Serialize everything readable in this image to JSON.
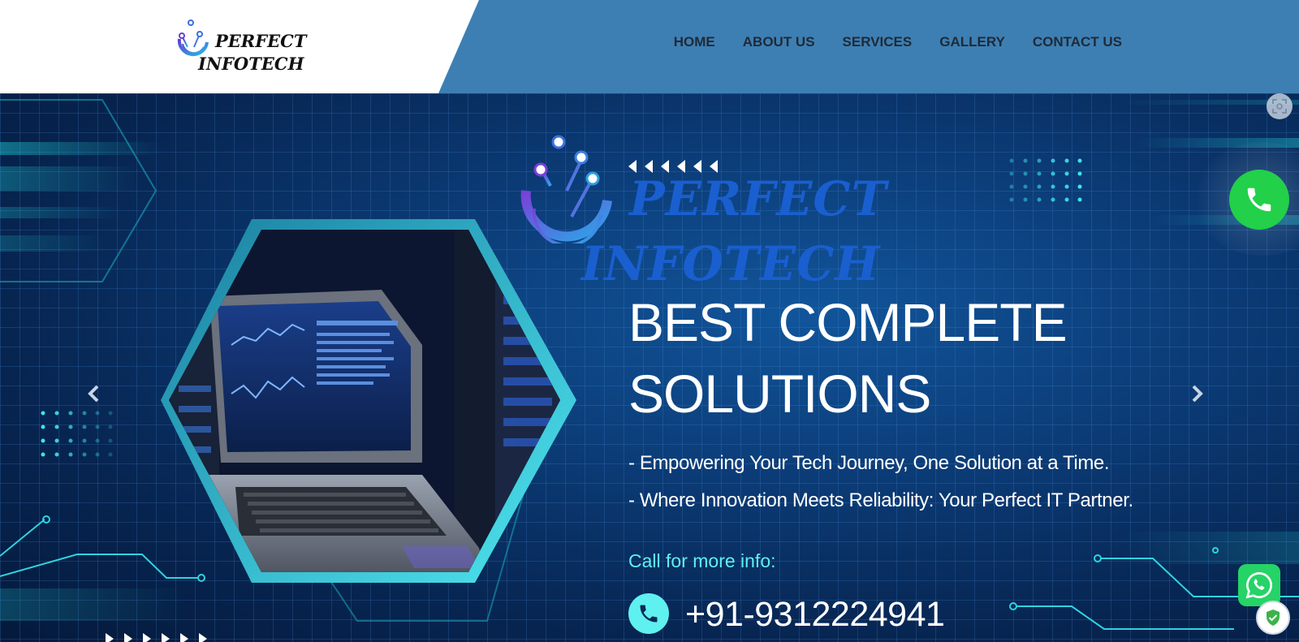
{
  "brand": {
    "line1": "PERFECT",
    "line2": "INFOTECH"
  },
  "nav": {
    "items": [
      {
        "label": "HOME"
      },
      {
        "label": "ABOUT US"
      },
      {
        "label": "SERVICES"
      },
      {
        "label": "GALLERY"
      },
      {
        "label": "CONTACT US"
      }
    ]
  },
  "hero": {
    "logo_line1": "PERFECT",
    "logo_line2": "INFOTECH",
    "headline_line1": "BEST COMPLETE",
    "headline_line2": "SOLUTIONS",
    "tagline1": "- Empowering Your Tech Journey, One Solution at a Time.",
    "tagline2": "- Where Innovation Meets Reliability: Your Perfect IT Partner.",
    "call_label": "Call for more info:",
    "phone": "+91-9312224941"
  },
  "icons": {
    "carousel_prev": "chevron-left-icon",
    "carousel_next": "chevron-right-icon",
    "float_call": "phone-icon",
    "whatsapp": "whatsapp-icon",
    "shield": "shield-check-icon",
    "scan": "scan-icon"
  },
  "colors": {
    "header_bar": "#3d7fb3",
    "nav_text": "#1f2a37",
    "hero_logo": "#1a5fd0",
    "accent_cyan": "#5ff0f0",
    "call_green": "#22d04a",
    "whatsapp_green": "#25d366"
  }
}
